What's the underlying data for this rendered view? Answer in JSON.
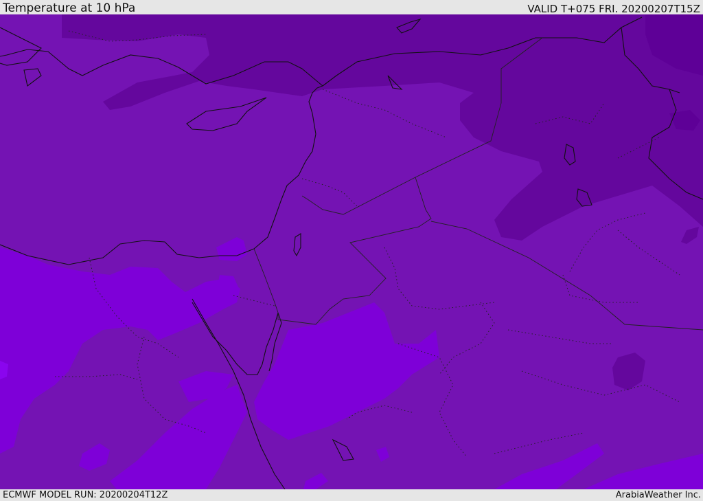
{
  "header": {
    "title": "Temperature at 10 hPa",
    "valid": "VALID T+075 FRI. 20200207T15Z"
  },
  "footer": {
    "model_run": "ECMWF MODEL RUN: 20200204T12Z",
    "brand": "ArabiaWeather Inc."
  },
  "colors": {
    "cold_deep": "#5e0097",
    "cold": "#64079d",
    "mid": "#7413b3",
    "warm": "#7e00d8",
    "warm_bright": "#8a05ee",
    "coastline": "#111111",
    "border": "#222222"
  }
}
